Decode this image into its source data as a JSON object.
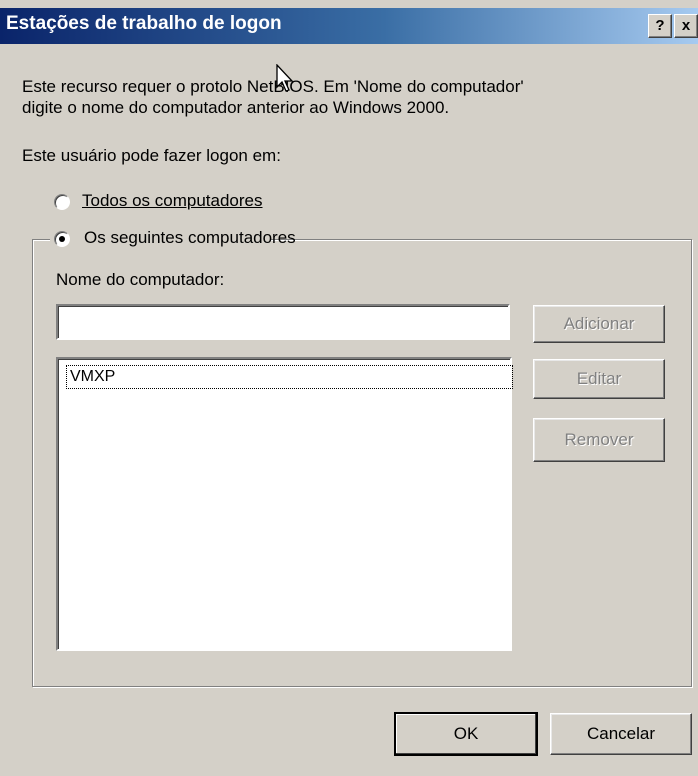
{
  "window": {
    "title": "Estações de trabalho de logon",
    "help_label": "?",
    "close_label": "x"
  },
  "description": {
    "line1": "Este recurso requer o proto",
    "line1_rest": "lo NetBIOS. Em 'Nome do computador'",
    "line2": "digite o nome do computador anterior ao Windows 2000."
  },
  "logon_label": "Este usuário pode fazer logon em:",
  "options": {
    "all_computers": {
      "label": "Todos os computadores",
      "selected": false
    },
    "following_computers": {
      "label": "Os seguintes computadores",
      "selected": true
    }
  },
  "computer_name": {
    "label": "Nome do computador:",
    "value": "",
    "list": [
      "VMXP"
    ]
  },
  "buttons": {
    "add": "Adicionar",
    "edit": "Editar",
    "remove": "Remover",
    "ok": "OK",
    "cancel": "Cancelar"
  }
}
